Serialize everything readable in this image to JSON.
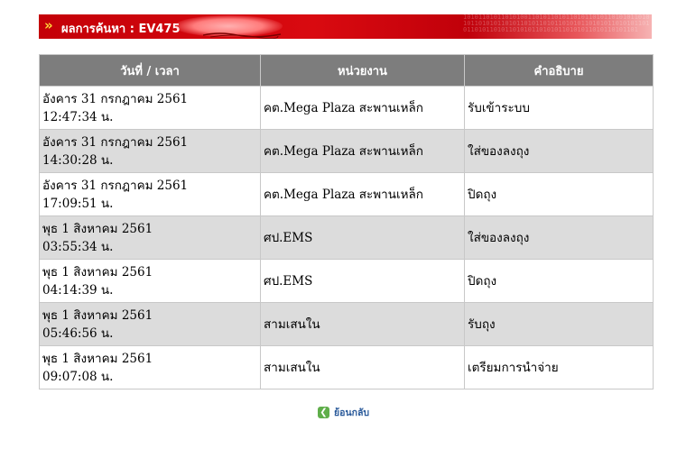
{
  "header": {
    "arrows": "»",
    "label": "ผลการค้นหา : EV475",
    "bg_digits": "101011010110101001101011010110101101011010101101010110101011010110101101011010101101010110101011010110101101011010101101010110101011010110101101",
    "colors": {
      "banner": "#c40008",
      "arrows": "#ffd83a"
    }
  },
  "table": {
    "columns": [
      "วันที่ / เวลา",
      "หน่วยงาน",
      "คำอธิบาย"
    ],
    "rows": [
      {
        "date": "อังคาร 31 กรกฎาคม 2561",
        "time": "12:47:34 น.",
        "unit": "คต.Mega Plaza สะพานเหล็ก",
        "description": "รับเข้าระบบ"
      },
      {
        "date": "อังคาร 31 กรกฎาคม 2561",
        "time": "14:30:28 น.",
        "unit": "คต.Mega Plaza สะพานเหล็ก",
        "description": "ใส่ของลงถุง"
      },
      {
        "date": "อังคาร 31 กรกฎาคม 2561",
        "time": "17:09:51 น.",
        "unit": "คต.Mega Plaza สะพานเหล็ก",
        "description": "ปิดถุง"
      },
      {
        "date": "พุธ 1 สิงหาคม 2561",
        "time": "03:55:34 น.",
        "unit": "ศป.EMS",
        "description": "ใส่ของลงถุง"
      },
      {
        "date": "พุธ 1 สิงหาคม 2561",
        "time": "04:14:39 น.",
        "unit": "ศป.EMS",
        "description": "ปิดถุง"
      },
      {
        "date": "พุธ 1 สิงหาคม 2561",
        "time": "05:46:56 น.",
        "unit": "สามเสนใน",
        "description": "รับถุง"
      },
      {
        "date": "พุธ 1 สิงหาคม 2561",
        "time": "09:07:08 น.",
        "unit": "สามเสนใน",
        "description": "เตรียมการนำจ่าย"
      }
    ],
    "colors": {
      "header_bg": "#7d7d7d",
      "alt_row_bg": "#dcdcdc"
    }
  },
  "footer": {
    "back_label": "ย้อนกลับ",
    "back_icon": "back-arrow-icon"
  }
}
